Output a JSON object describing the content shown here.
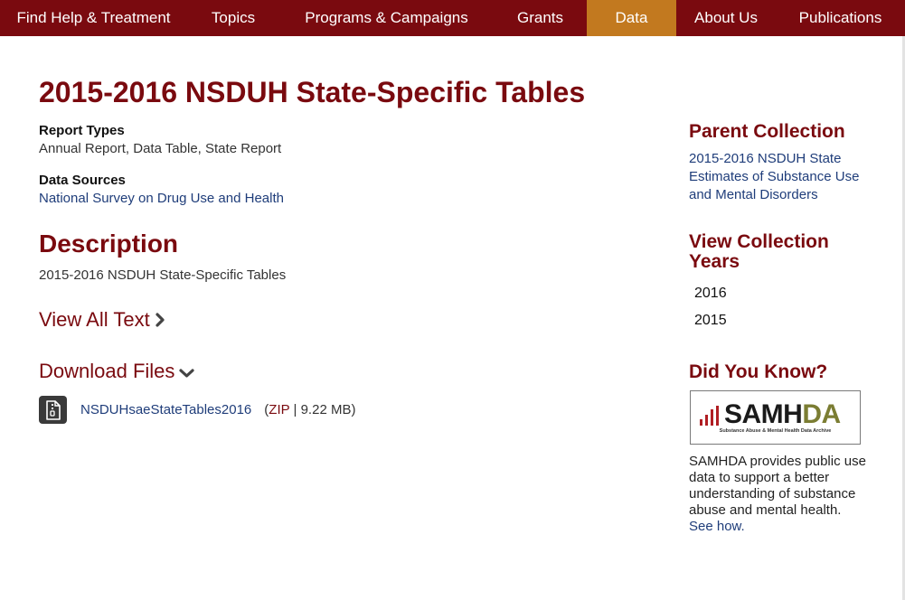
{
  "nav": {
    "items": [
      {
        "label": "Find Help & Treatment"
      },
      {
        "label": "Topics"
      },
      {
        "label": "Programs & Campaigns"
      },
      {
        "label": "Grants"
      },
      {
        "label": "Data",
        "active": true
      },
      {
        "label": "About Us"
      },
      {
        "label": "Publications"
      }
    ]
  },
  "page": {
    "title": "2015-2016 NSDUH State-Specific Tables",
    "report_types_label": "Report Types",
    "report_types_value": "Annual Report, Data Table, State Report",
    "data_sources_label": "Data Sources",
    "data_sources_value": "National Survey on Drug Use and Health",
    "description_heading": "Description",
    "description_text": "2015-2016 NSDUH State-Specific Tables",
    "view_all_text": "View All Text",
    "download_files": "Download Files",
    "file": {
      "name": "NSDUHsaeStateTables2016",
      "open_paren": "(",
      "type": "ZIP",
      "separator": " | ",
      "size": "9.22 MB",
      "close_paren": ")"
    }
  },
  "sidebar": {
    "parent_collection_heading": "Parent Collection",
    "parent_collection_link": "2015-2016 NSDUH State Estimates of Substance Use and Mental Disorders",
    "view_years_heading_line1": "View Collection",
    "view_years_heading_line2": "Years",
    "years": [
      "2016",
      "2015"
    ],
    "did_you_know_heading": "Did You Know?",
    "samhda": {
      "word_main": "SAMH",
      "word_accent": "DA",
      "subtitle": "Substance Abuse & Mental Health Data Archive"
    },
    "did_you_know_text": "SAMHDA provides public use data to support a better understanding of substance abuse and mental health.",
    "see_how": "See how."
  },
  "colors": {
    "nav_bg": "#7a0a0f",
    "nav_active": "#c2791f",
    "heading": "#7a0a0f",
    "link": "#1f3d7a",
    "samhda_accent": "#7b7d33",
    "samhda_bars": "#b01e23"
  },
  "icons": {
    "view_all_chevron": "chevron-right-icon",
    "download_chevron": "chevron-down-icon",
    "file": "zip-file-icon"
  }
}
